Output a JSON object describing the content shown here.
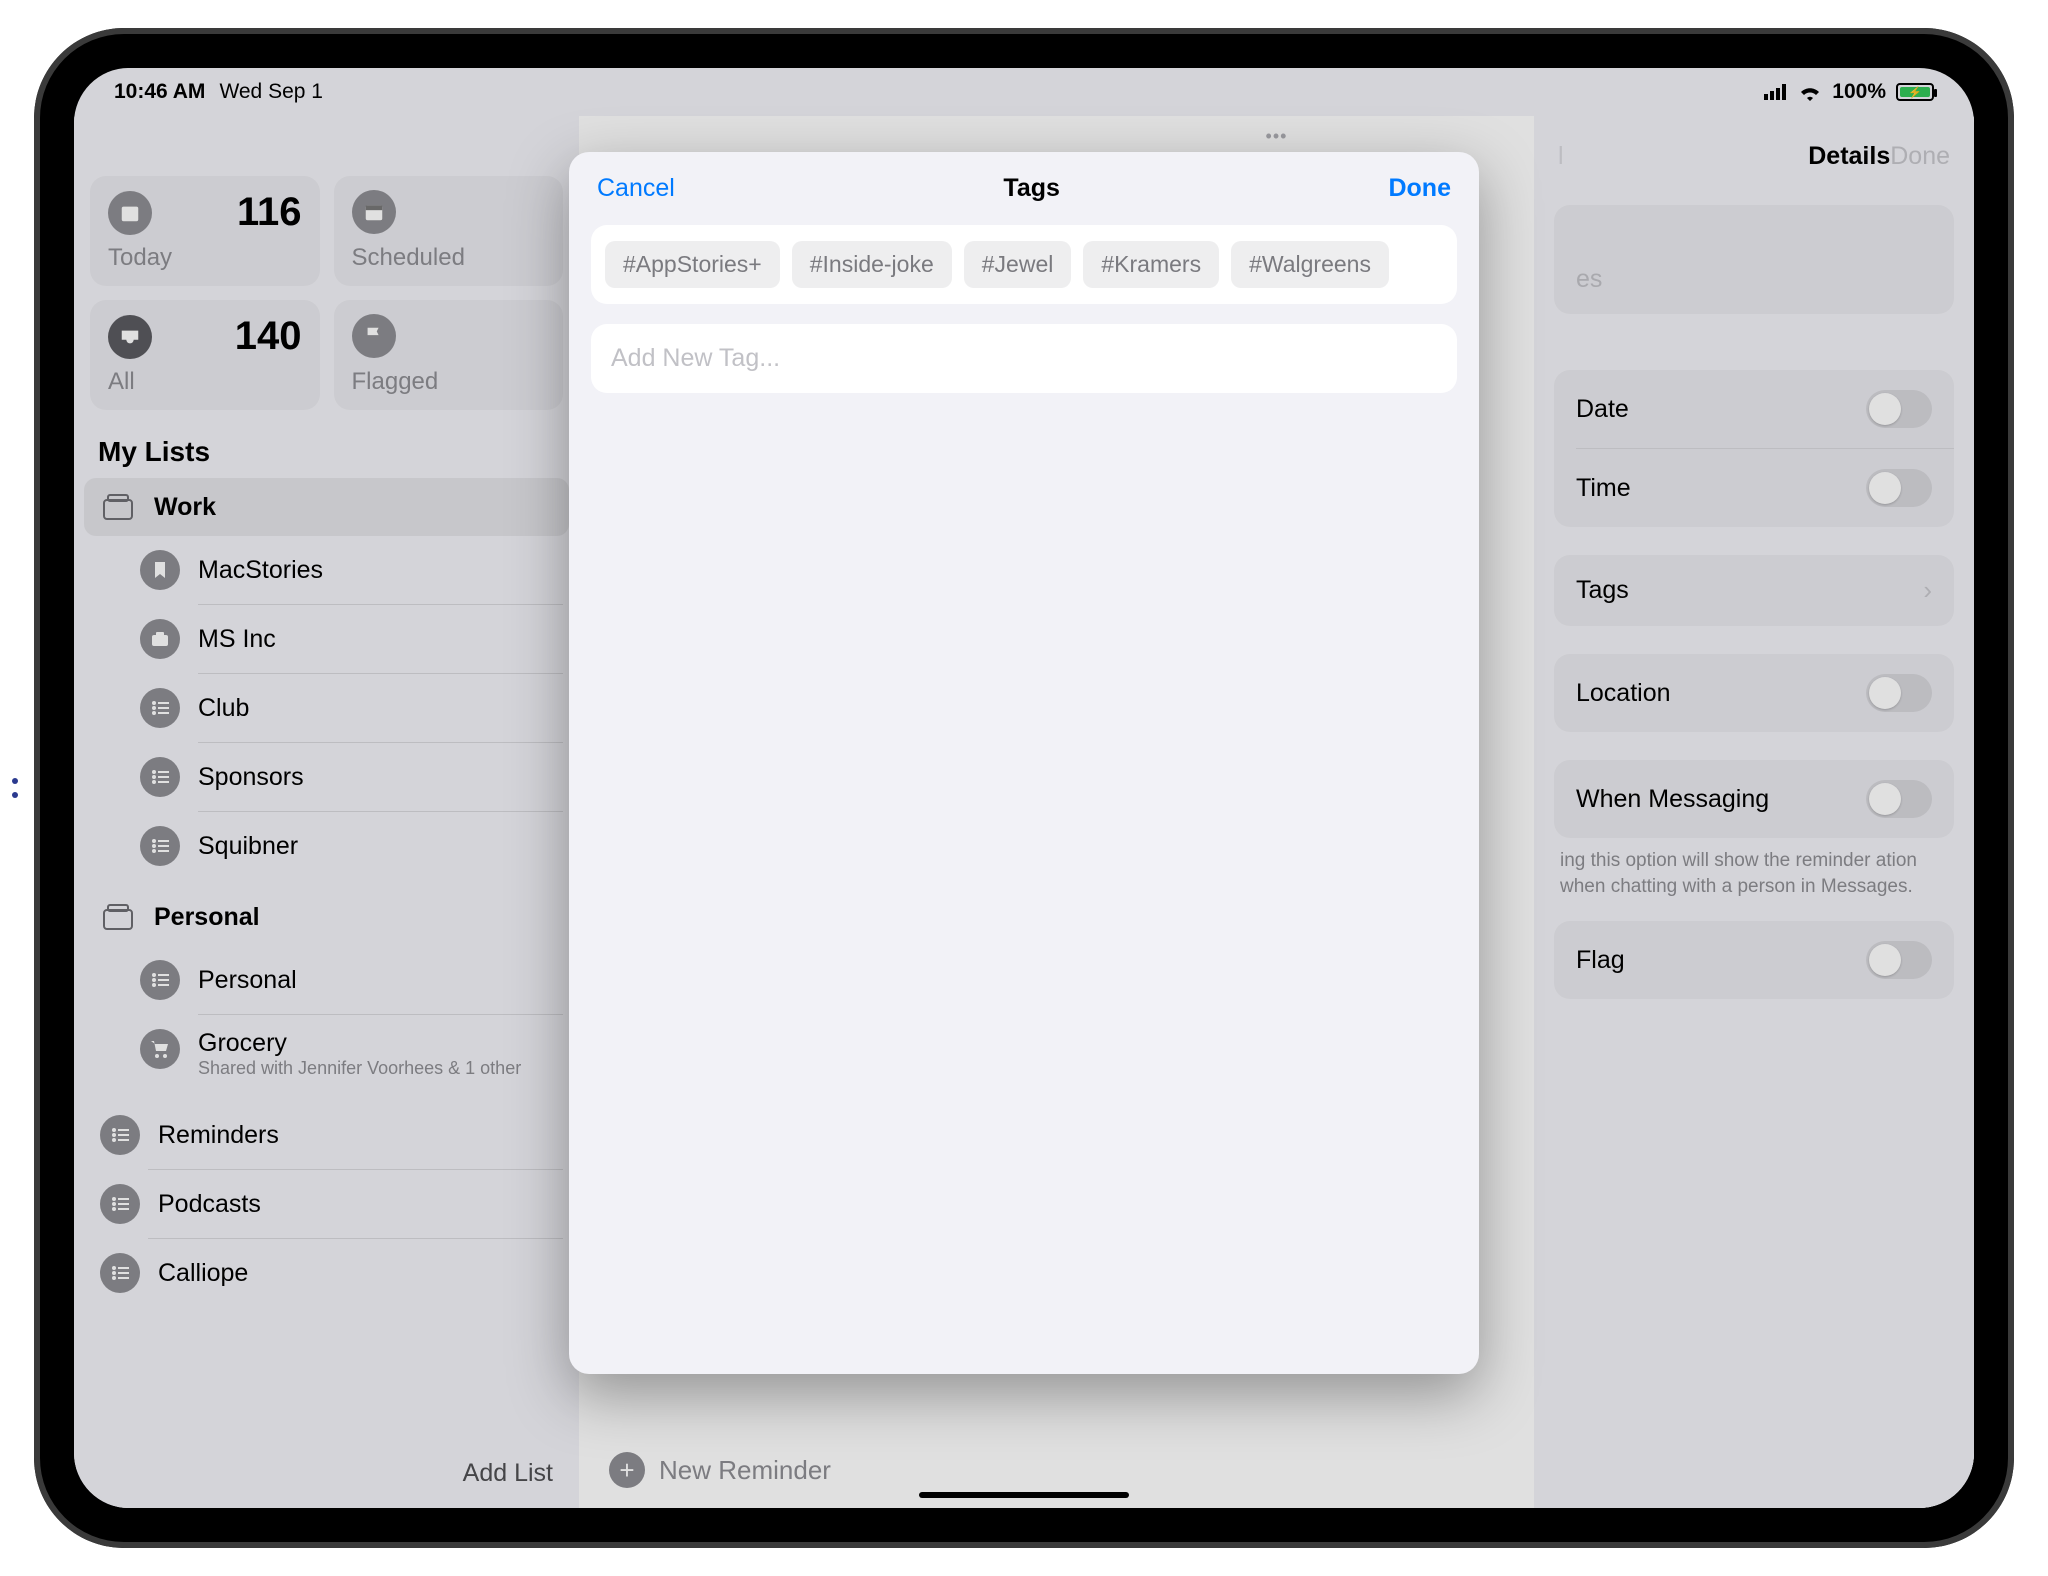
{
  "status": {
    "time": "10:46 AM",
    "date": "Wed Sep 1",
    "battery_pct": "100%"
  },
  "sidebar": {
    "cards": {
      "today": {
        "label": "Today",
        "count": "116"
      },
      "scheduled": {
        "label": "Scheduled",
        "count": ""
      },
      "all": {
        "label": "All",
        "count": "140"
      },
      "flagged": {
        "label": "Flagged",
        "count": ""
      }
    },
    "section": "My Lists",
    "groups": [
      {
        "label": "Work",
        "items": [
          "MacStories",
          "MS Inc",
          "Club",
          "Sponsors",
          "Squibner"
        ]
      },
      {
        "label": "Personal",
        "items": [
          {
            "label": "Personal"
          },
          {
            "label": "Grocery",
            "sub": "Shared with Jennifer Voorhees & 1 other"
          }
        ]
      }
    ],
    "loose": [
      "Reminders",
      "Podcasts",
      "Calliope"
    ],
    "add_list": "Add List"
  },
  "main": {
    "new_reminder": "New Reminder"
  },
  "details": {
    "title": "Details",
    "done": "Done",
    "cancel_stub": "l",
    "rows": {
      "es_stub": "es",
      "date": "Date",
      "time": "Time",
      "tags": "Tags",
      "location": "Location",
      "messaging": "When Messaging",
      "flag": "Flag"
    },
    "note": "ing this option will show the reminder ation when chatting with a person in Messages."
  },
  "modal": {
    "cancel": "Cancel",
    "title": "Tags",
    "done": "Done",
    "tags": [
      "#AppStories+",
      "#Inside-joke",
      "#Jewel",
      "#Kramers",
      "#Walgreens"
    ],
    "placeholder": "Add New Tag..."
  }
}
